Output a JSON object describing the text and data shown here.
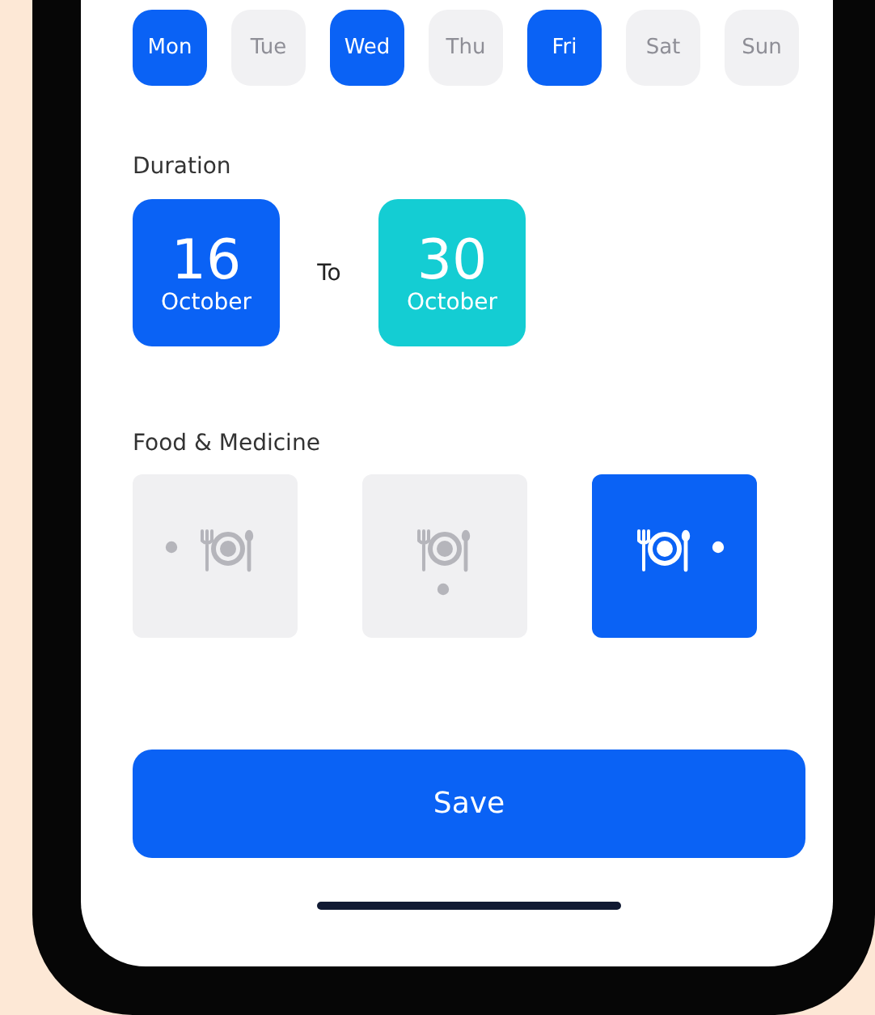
{
  "days": [
    {
      "label": "Mon",
      "selected": true
    },
    {
      "label": "Tue",
      "selected": false
    },
    {
      "label": "Wed",
      "selected": true
    },
    {
      "label": "Thu",
      "selected": false
    },
    {
      "label": "Fri",
      "selected": true
    },
    {
      "label": "Sat",
      "selected": false
    },
    {
      "label": "Sun",
      "selected": false
    }
  ],
  "duration": {
    "label": "Duration",
    "from": {
      "day": "16",
      "month": "October"
    },
    "separator": "To",
    "to": {
      "day": "30",
      "month": "October"
    }
  },
  "food_medicine": {
    "label": "Food & Medicine",
    "options": [
      {
        "kind": "left",
        "selected": false
      },
      {
        "kind": "bottom",
        "selected": false
      },
      {
        "kind": "right",
        "selected": true
      }
    ]
  },
  "save_button": "Save"
}
